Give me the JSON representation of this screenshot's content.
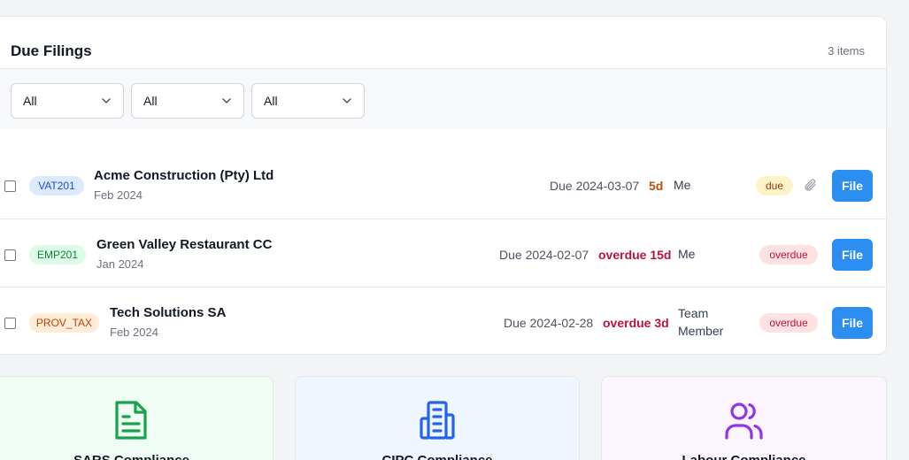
{
  "panel": {
    "title": "Due Filings",
    "count": "3 items"
  },
  "filters": [
    {
      "value": "All"
    },
    {
      "value": "All"
    },
    {
      "value": "All"
    }
  ],
  "rows": [
    {
      "type": "VAT201",
      "client": "Acme Construction (Pty) Ltd",
      "period": "Feb 2024",
      "due": "Due 2024-03-07",
      "days": "5d",
      "assignee": "Me",
      "status": "due",
      "action": "File"
    },
    {
      "type": "EMP201",
      "client": "Green Valley Restaurant CC",
      "period": "Jan 2024",
      "due": "Due 2024-02-07",
      "days": "overdue 15d",
      "assignee": "Me",
      "status": "overdue",
      "action": "File"
    },
    {
      "type": "PROV_TAX",
      "client": "Tech Solutions SA",
      "period": "Feb 2024",
      "due": "Due 2024-02-28",
      "days": "overdue 3d",
      "assignee_line1": "Team",
      "assignee_line2": "Member",
      "status": "overdue",
      "action": "File"
    }
  ],
  "tiles": [
    {
      "label": "SARS Compliance",
      "icon": "document-icon",
      "color": "#16a34a"
    },
    {
      "label": "CIPC Compliance",
      "icon": "building-icon",
      "color": "#2563eb"
    },
    {
      "label": "Labour Compliance",
      "icon": "users-icon",
      "color": "#9333ea"
    }
  ],
  "colors": {
    "accent": "#2b8ef0",
    "overdue": "#be123c",
    "due_soon": "#b45309"
  }
}
